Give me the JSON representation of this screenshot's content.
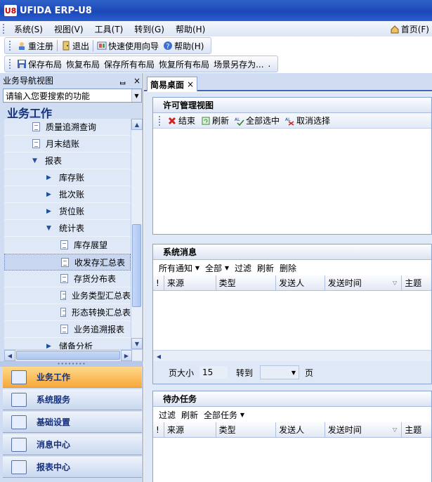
{
  "app": {
    "title": "UFIDA ERP-U8",
    "logo": "U8",
    "home_label": "首页(F)"
  },
  "menu": [
    "系统(S)",
    "视图(V)",
    "工具(T)",
    "转到(G)",
    "帮助(H)"
  ],
  "toolbar1": {
    "relogin": "重注册",
    "exit": "退出",
    "quickguide": "快速使用向导",
    "help": "帮助(H)"
  },
  "toolbar2": {
    "save_layout": "保存布局",
    "restore_layout": "恢复布局",
    "save_all": "保存所有布局",
    "restore_all": "恢复所有布局",
    "save_scene": "场景另存为...",
    "more": "."
  },
  "nav": {
    "header": "业务导航视图",
    "pin": "ᆸ",
    "close": "×",
    "search_placeholder": "请输入您要搜索的功能",
    "section_title": "业务工作",
    "tree": [
      {
        "label": "质量追溯查询",
        "kind": "doc",
        "indent": 40
      },
      {
        "label": "月末结账",
        "kind": "doc",
        "indent": 40
      },
      {
        "label": "报表",
        "kind": "open",
        "indent": 40
      },
      {
        "label": "库存账",
        "kind": "closed",
        "indent": 60
      },
      {
        "label": "批次账",
        "kind": "closed",
        "indent": 60
      },
      {
        "label": "货位账",
        "kind": "closed",
        "indent": 60
      },
      {
        "label": "统计表",
        "kind": "open",
        "indent": 60
      },
      {
        "label": "库存展望",
        "kind": "doc",
        "indent": 80
      },
      {
        "label": "收发存汇总表",
        "kind": "doc",
        "indent": 80,
        "selected": true
      },
      {
        "label": "存货分布表",
        "kind": "doc",
        "indent": 80
      },
      {
        "label": "业务类型汇总表",
        "kind": "doc",
        "indent": 80
      },
      {
        "label": "形态转换汇总表",
        "kind": "doc",
        "indent": 80
      },
      {
        "label": "业务追溯报表",
        "kind": "doc",
        "indent": 80
      },
      {
        "label": "储备分析",
        "kind": "closed",
        "indent": 60
      }
    ],
    "buttons": [
      {
        "label": "业务工作",
        "active": true
      },
      {
        "label": "系统服务",
        "active": false
      },
      {
        "label": "基础设置",
        "active": false
      },
      {
        "label": "消息中心",
        "active": false
      },
      {
        "label": "报表中心",
        "active": false
      }
    ]
  },
  "tab": {
    "label": "简易桌面",
    "close": "×"
  },
  "license_panel": {
    "title": "许可管理视图",
    "actions": [
      "结束",
      "刷新",
      "全部选中",
      "取消选择"
    ]
  },
  "message_panel": {
    "title": "系统消息",
    "filters": [
      "所有通知",
      "全部",
      "过滤",
      "刷新",
      "删除"
    ],
    "columns": [
      "!",
      "来源",
      "类型",
      "发送人",
      "发送时间",
      "主题"
    ],
    "pager": {
      "page_size_label": "页大小",
      "page_size": "15",
      "goto_label": "转到",
      "page_label": "页"
    }
  },
  "todo_panel": {
    "title": "待办任务",
    "filters": [
      "过滤",
      "刷新",
      "全部任务"
    ],
    "columns": [
      "!",
      "来源",
      "类型",
      "发送人",
      "发送时间",
      "主题"
    ]
  },
  "colors": {
    "title_blue": "#1d47b8",
    "active_orange": "#f7a83b",
    "nav_text": "#15317e"
  }
}
